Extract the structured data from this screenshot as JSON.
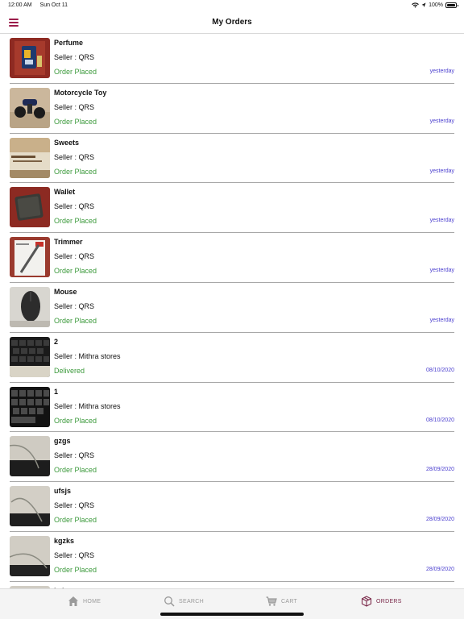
{
  "status_bar": {
    "time": "12:00 AM",
    "date": "Sun Oct 11",
    "battery": "100%"
  },
  "header": {
    "title": "My Orders"
  },
  "colors": {
    "accent": "#9b1c4a",
    "status_green": "#3c9a3c",
    "date_blue": "#4b3fcf",
    "tab_active": "#7b2a4a"
  },
  "orders": [
    {
      "name": "Perfume",
      "seller": "Seller : QRS",
      "status": "Order Placed",
      "date": "yesterday",
      "thumb": "perfume"
    },
    {
      "name": "Motorcycle Toy",
      "seller": "Seller : QRS",
      "status": "Order Placed",
      "date": "yesterday",
      "thumb": "toy"
    },
    {
      "name": "Sweets",
      "seller": "Seller : QRS",
      "status": "Order Placed",
      "date": "yesterday",
      "thumb": "sweets"
    },
    {
      "name": "Wallet",
      "seller": "Seller : QRS",
      "status": "Order Placed",
      "date": "yesterday",
      "thumb": "wallet"
    },
    {
      "name": "Trimmer",
      "seller": "Seller : QRS",
      "status": "Order Placed",
      "date": "yesterday",
      "thumb": "trimmer"
    },
    {
      "name": "Mouse",
      "seller": "Seller : QRS",
      "status": "Order Placed",
      "date": "yesterday",
      "thumb": "mouse"
    },
    {
      "name": "2",
      "seller": "Seller : Mithra stores",
      "status": "Delivered",
      "date": "08/10/2020",
      "thumb": "keyboard"
    },
    {
      "name": "1",
      "seller": "Seller : Mithra stores",
      "status": "Order Placed",
      "date": "08/10/2020",
      "thumb": "keyboard"
    },
    {
      "name": "gzgs",
      "seller": "Seller : QRS",
      "status": "Order Placed",
      "date": "28/09/2020",
      "thumb": "cable"
    },
    {
      "name": "ufsjs",
      "seller": "Seller : QRS",
      "status": "Order Placed",
      "date": "28/09/2020",
      "thumb": "cable"
    },
    {
      "name": "kgzks",
      "seller": "Seller : QRS",
      "status": "Order Placed",
      "date": "28/09/2020",
      "thumb": "cable"
    },
    {
      "name": "lzdz",
      "seller": "",
      "status": "",
      "date": "",
      "thumb": "cable"
    }
  ],
  "tabs": [
    {
      "label": "HOME",
      "icon": "home-icon",
      "active": false
    },
    {
      "label": "SEARCH",
      "icon": "search-icon",
      "active": false
    },
    {
      "label": "CART",
      "icon": "cart-icon",
      "active": false
    },
    {
      "label": "ORDERS",
      "icon": "box-icon",
      "active": true
    }
  ]
}
